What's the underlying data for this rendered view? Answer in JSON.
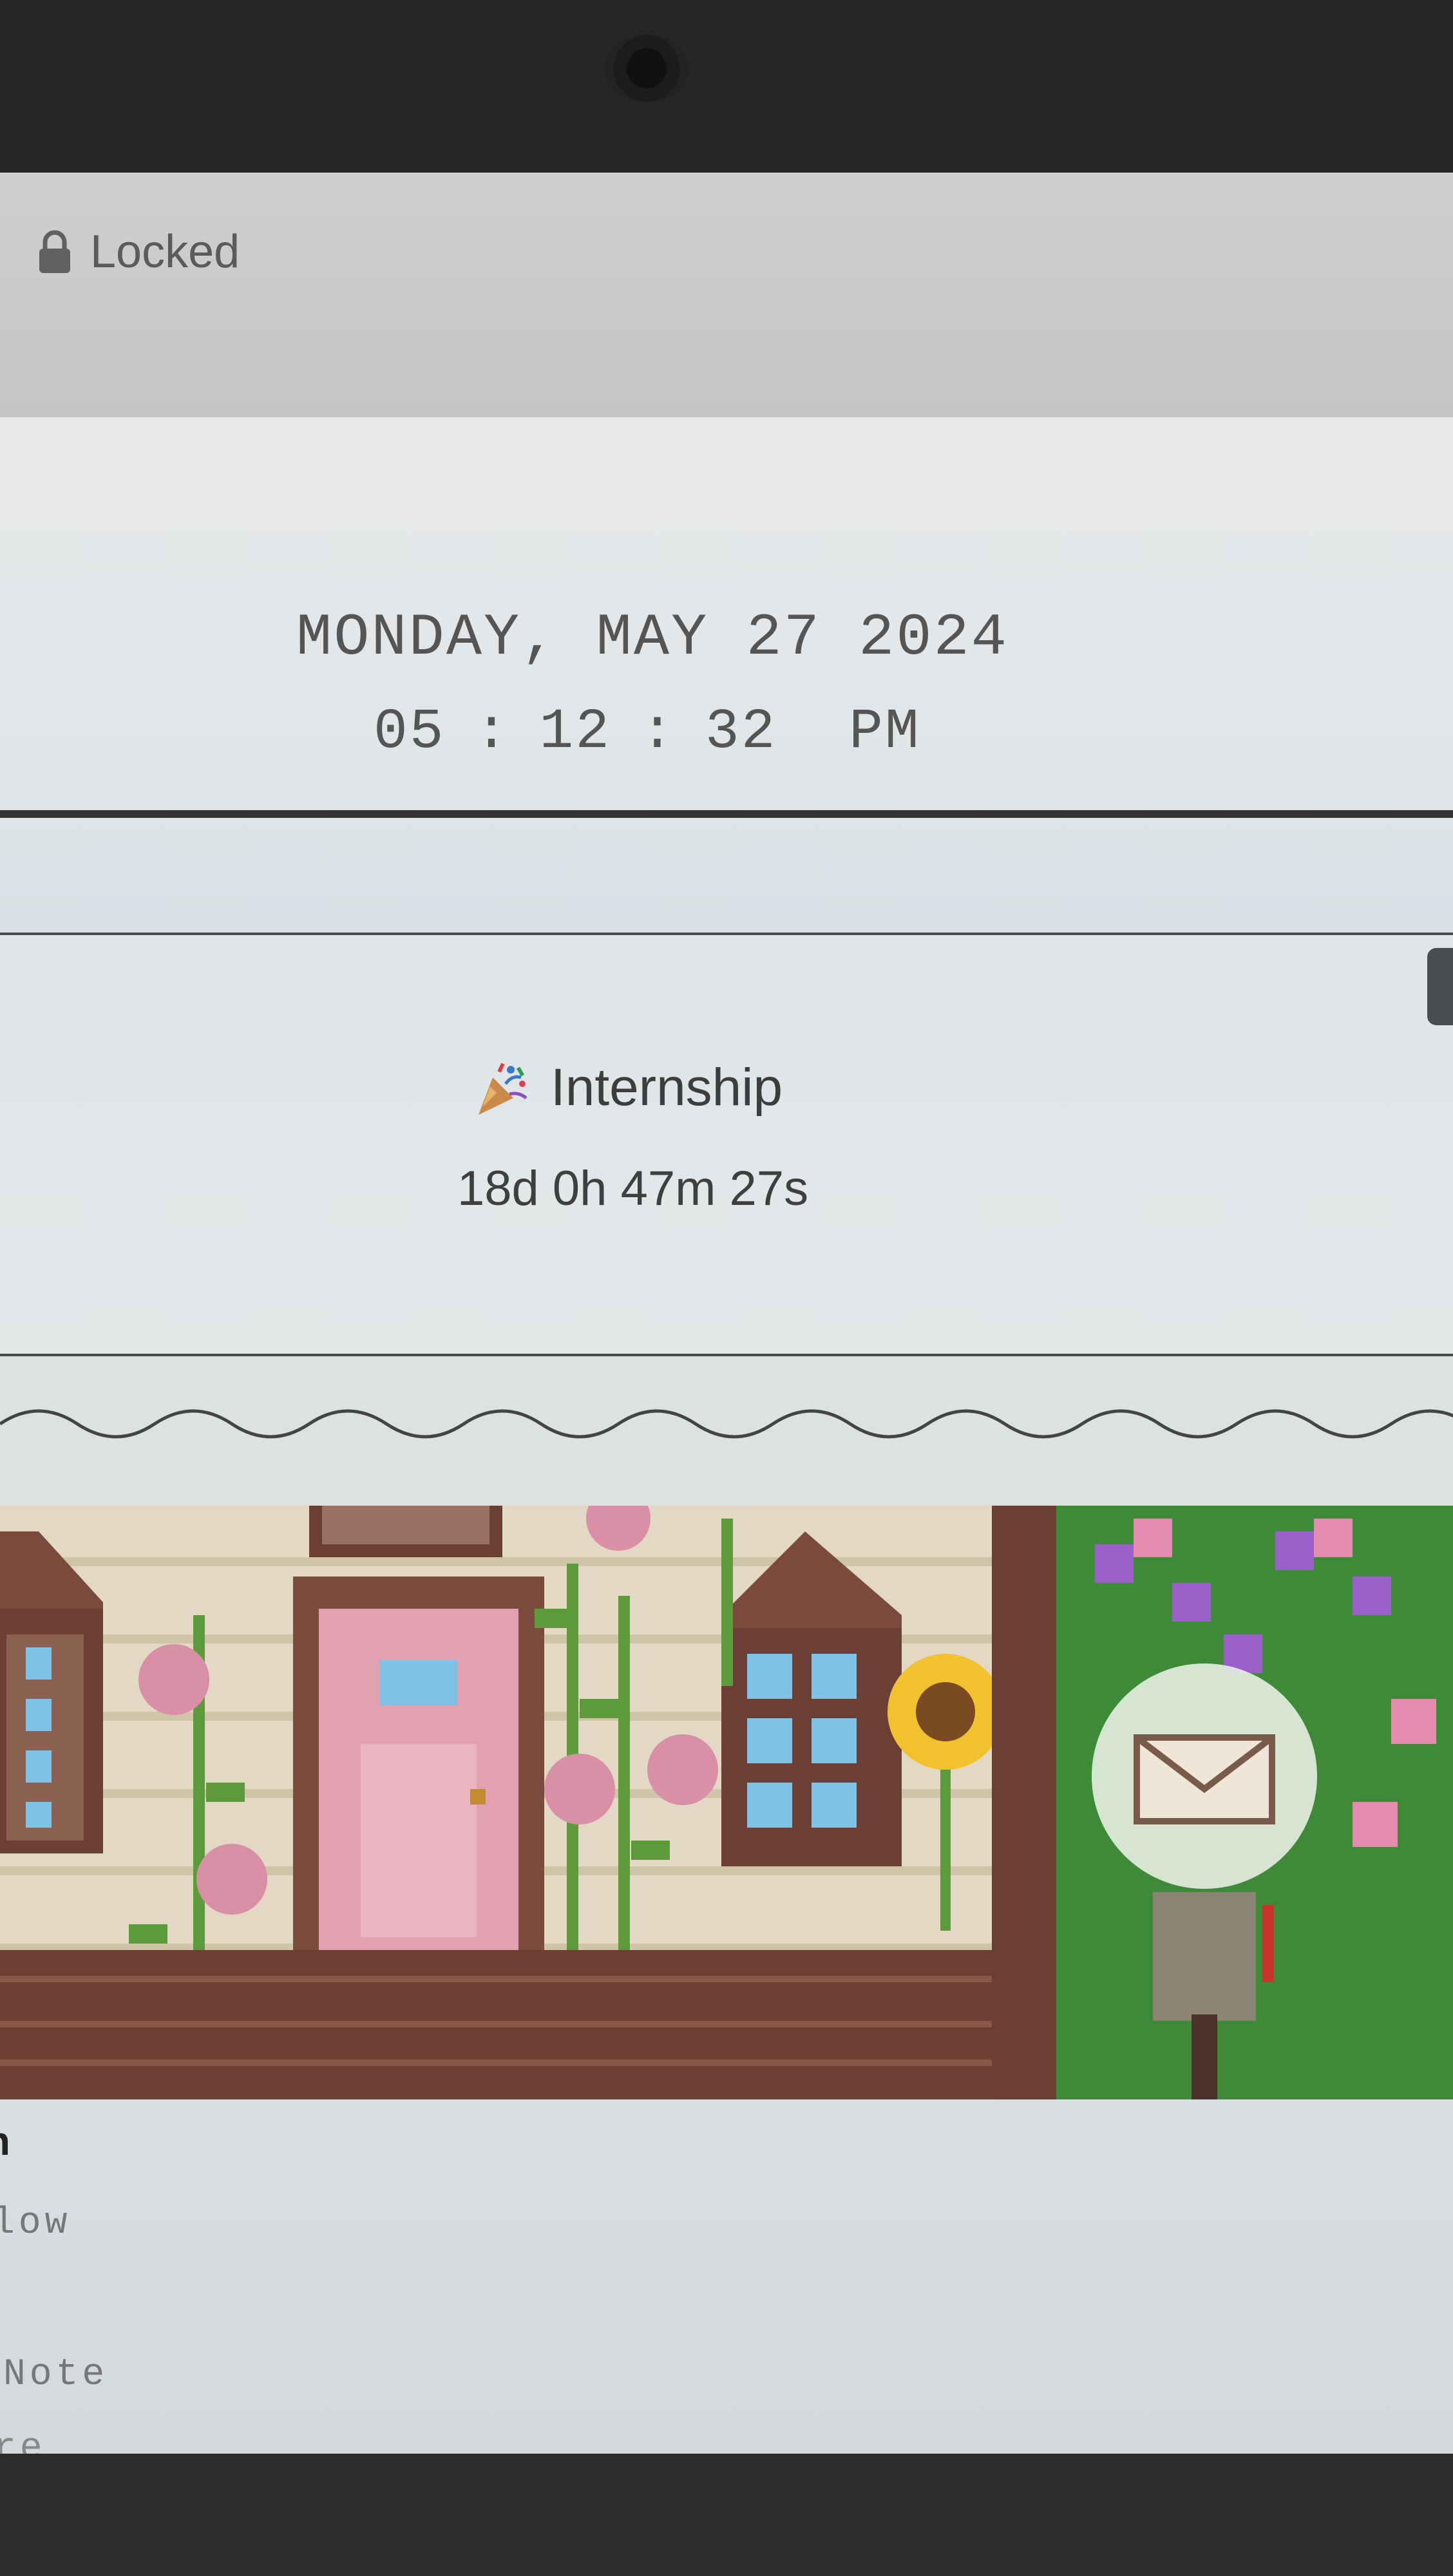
{
  "status": {
    "lock_label": "Locked",
    "lock_icon": "lock-icon"
  },
  "clock": {
    "date": "MONDAY, MAY 27 2024",
    "hours": "05",
    "minutes": "12",
    "seconds": "32",
    "ampm": "PM",
    "separator": ":"
  },
  "countdown": {
    "icon": "party-popper-icon",
    "title": "Internship",
    "remaining": "18d 0h 47m 27s"
  },
  "lower_panel": {
    "line_heading": "n",
    "line_1": "low",
    "line_2": "Note",
    "line_3": "re"
  },
  "colors": {
    "background": "#d9dadb",
    "text": "#555555",
    "bezel": "#262626"
  }
}
